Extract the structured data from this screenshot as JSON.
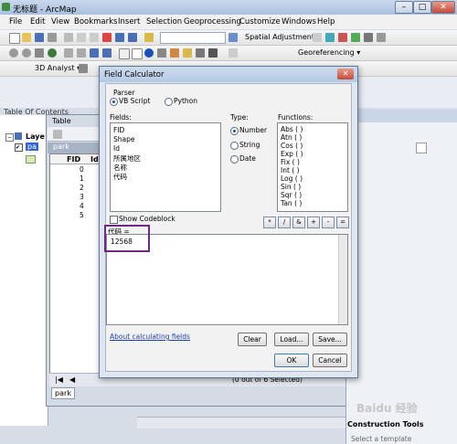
{
  "app": {
    "title": "无标题 - ArcMap"
  },
  "menu": [
    "File",
    "Edit",
    "View",
    "Bookmarks",
    "Insert",
    "Selection",
    "Geoprocessing",
    "Customize",
    "Windows",
    "Help"
  ],
  "toolbars": {
    "spatial_adjustment": "Spatial Adjustment ▾",
    "georeferencing": "Georeferencing ▾",
    "analyst_3d": "3D Analyst ▾"
  },
  "toc": {
    "title": "Table Of Contents",
    "layer_group": "Laye",
    "layer": "pa"
  },
  "table": {
    "title": "Table",
    "tab": "park",
    "headers": [
      "FID",
      "Id"
    ],
    "rows": [
      "0",
      "1",
      "2",
      "3",
      "4",
      "5"
    ],
    "status": "(0 out of 6 Selected)",
    "bottom_tab": "park"
  },
  "right_panel": {
    "construction_tools": "Construction Tools",
    "select_template": "Select a template"
  },
  "dialog": {
    "title": "Field Calculator",
    "parser_label": "Parser",
    "vbscript": "VB Script",
    "python": "Python",
    "fields_label": "Fields:",
    "fields": [
      "FID",
      "Shape",
      "Id",
      "所属地区",
      "名称",
      "代码"
    ],
    "type_label": "Type:",
    "types": [
      "Number",
      "String",
      "Date"
    ],
    "functions_label": "Functions:",
    "functions": [
      "Abs ( )",
      "Atn ( )",
      "Cos ( )",
      "Exp ( )",
      "Fix ( )",
      "Int ( )",
      "Log ( )",
      "Sin ( )",
      "Sqr ( )",
      "Tan ( )"
    ],
    "show_codeblock": "Show Codeblock",
    "operators": [
      "*",
      "/",
      "&",
      "+",
      "-",
      "="
    ],
    "expression_label": "代码 =",
    "expression_value": "12568",
    "about_link": "About calculating fields",
    "clear": "Clear",
    "load": "Load...",
    "save": "Save...",
    "ok": "OK",
    "cancel": "Cancel"
  },
  "watermark": "Baidu 经验"
}
